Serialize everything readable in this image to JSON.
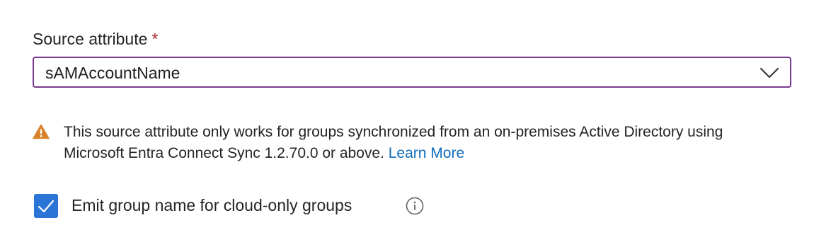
{
  "source_attribute": {
    "label": "Source attribute",
    "required_marker": "*",
    "selected_value": "sAMAccountName",
    "dropdown_icon": "chevron-down-icon"
  },
  "warning": {
    "icon": "warning-icon",
    "text": "This source attribute only works for groups synchronized from an on-premises Active Directory using Microsoft Entra Connect Sync 1.2.70.0 or above.",
    "link_label": "Learn More"
  },
  "emit_group_name": {
    "checked": true,
    "label": "Emit group name for cloud-only groups",
    "info_icon": "info-icon"
  },
  "colors": {
    "dropdown_border": "#7a3b8f",
    "required": "#a4262c",
    "warning": "#d9822b",
    "link": "#0f6cbd",
    "checkbox": "#2b75d6"
  }
}
